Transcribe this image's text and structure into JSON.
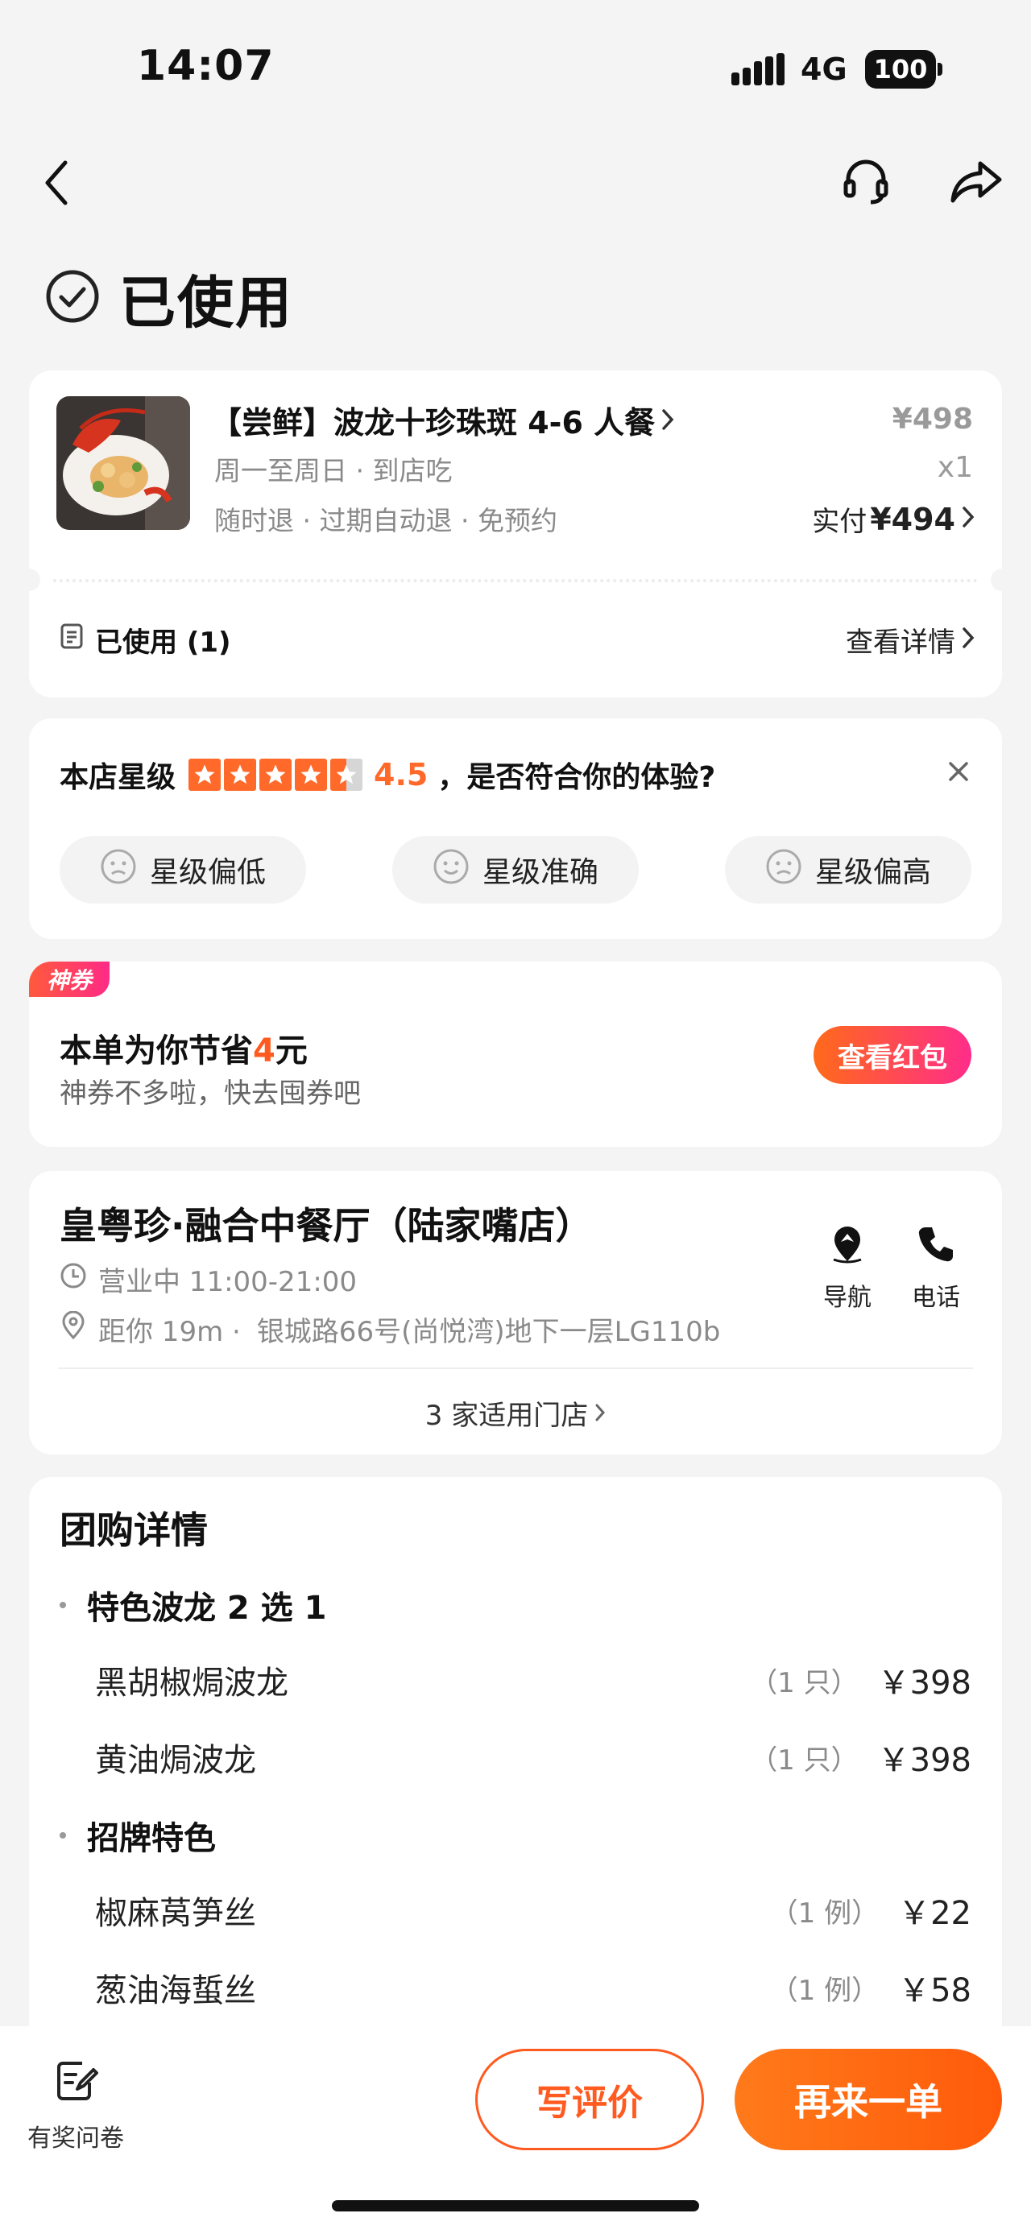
{
  "status": {
    "time": "14:07",
    "network": "4G",
    "battery": "100"
  },
  "page": {
    "title": "已使用"
  },
  "order": {
    "title": "【尝鲜】波龙十珍珠斑 4-6 人餐",
    "schedule": "周一至周日 · 到店吃",
    "policy": "随时退 · 过期自动退 · 免预约",
    "original_price": "¥498",
    "quantity": "x1",
    "paid_label": "实付",
    "paid_amount": "¥494",
    "used_label": "已使用 (1)",
    "detail_link": "查看详情"
  },
  "rating": {
    "prefix": "本店星级",
    "score": "4.5",
    "question": "，是否符合你的体验?",
    "options": [
      "星级偏低",
      "星级准确",
      "星级偏高"
    ],
    "stars_value": 4.5
  },
  "coupon": {
    "tag": "神券",
    "save_prefix": "本单为你节省",
    "save_amount": "4",
    "save_unit": "元",
    "subtitle": "神券不多啦，快去囤券吧",
    "button": "查看红包"
  },
  "store": {
    "name": "皇粤珍·融合中餐厅（陆家嘴店）",
    "hours": "营业中 11:00-21:00",
    "distance": "距你 19m ·",
    "address": "银城路66号(尚悦湾)地下一层LG110b",
    "nav_label": "导航",
    "phone_label": "电话",
    "stores_link": "3 家适用门店"
  },
  "details": {
    "title": "团购详情",
    "groups": [
      {
        "name": "特色波龙 2 选 1",
        "items": [
          {
            "name": "黑胡椒焗波龙",
            "qty": "（1 只）",
            "price": "￥398"
          },
          {
            "name": "黄油焗波龙",
            "qty": "（1 只）",
            "price": "￥398"
          }
        ]
      },
      {
        "name": "招牌特色",
        "items": [
          {
            "name": "椒麻莴笋丝",
            "qty": "（1 例）",
            "price": "￥22"
          },
          {
            "name": "葱油海蜇丝",
            "qty": "（1 例）",
            "price": "￥58"
          }
        ]
      }
    ]
  },
  "bottom": {
    "survey_label": "有奖问卷",
    "review_button": "写评价",
    "reorder_button": "再来一单"
  },
  "colors": {
    "accent": "#ff5a1f",
    "star": "#ff6a2a",
    "pink": "#ff2d8a"
  }
}
